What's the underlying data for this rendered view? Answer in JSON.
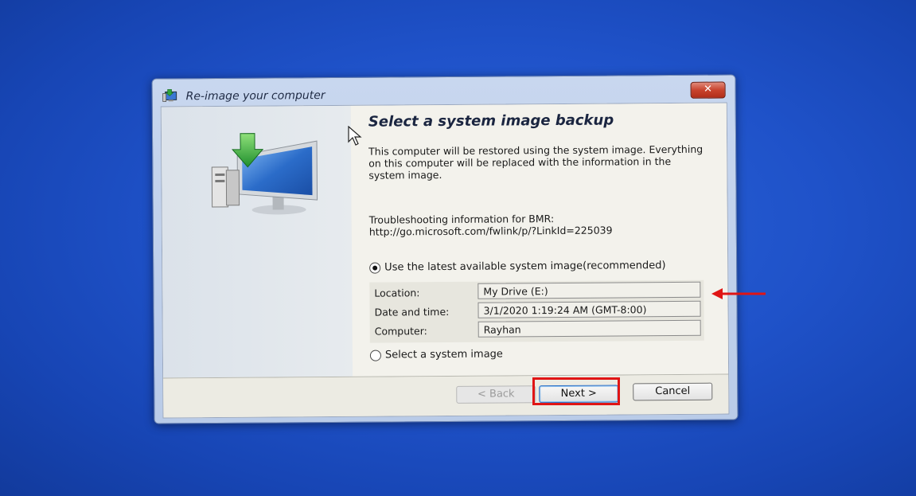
{
  "window": {
    "title": "Re-image your computer",
    "close_glyph": "✕"
  },
  "main": {
    "heading": "Select a system image backup",
    "description": "This computer will be restored using the system image. Everything on this computer will be replaced with the information in the system image.",
    "troubleshooting_label": "Troubleshooting information for BMR:",
    "troubleshooting_link": "http://go.microsoft.com/fwlink/p/?LinkId=225039",
    "option_latest": "Use the latest available system image(recommended)",
    "option_latest_selected": true,
    "info": {
      "location_label": "Location:",
      "location_value": "My Drive (E:)",
      "datetime_label": "Date and time:",
      "datetime_value": "3/1/2020 1:19:24 AM (GMT-8:00)",
      "computer_label": "Computer:",
      "computer_value": "Rayhan"
    },
    "option_select": "Select a system image",
    "option_select_selected": false
  },
  "footer": {
    "back_label": "< Back",
    "next_label": "Next >",
    "cancel_label": "Cancel"
  },
  "annotations": {
    "highlight_color": "#e01515"
  },
  "icons": {
    "title": "restore-computer-icon",
    "hero": "system-image-restore-icon",
    "cursor": "mouse-cursor-icon",
    "arrow": "red-arrow-icon"
  }
}
